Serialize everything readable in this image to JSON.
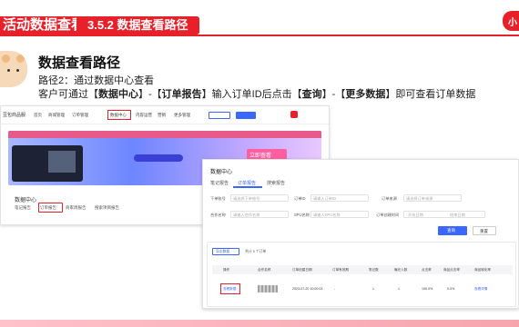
{
  "header": {
    "tag": "活动数据查看",
    "section": "3.5.2 数据查看路径",
    "brand": "小"
  },
  "content": {
    "title": "数据查看路径",
    "line1": "路径2：通过数据中心查看",
    "line2_prefix": "客户可通过【",
    "line2_parts": [
      "数据中心",
      "】-【",
      "订单报告",
      "】输入订单ID后点击【",
      "查询",
      "】-【",
      "更多数据",
      "】即可查看订单数据"
    ]
  },
  "shot1": {
    "logo": "豆包商品服",
    "nav": [
      "首页",
      "商城管理",
      "订单管理",
      "数据中心",
      "内容运营",
      "营销",
      "更多管理"
    ],
    "section_title": "数据中心",
    "tabs": [
      "笔记报告",
      "订单报告",
      "商家周报告",
      "搜索项目报告"
    ],
    "banner_text": "开播有礼",
    "banner_cta": "立即查看"
  },
  "shot2": {
    "title": "数据中心",
    "tabs": [
      "笔记报告",
      "订单报告",
      "搜索报告"
    ],
    "filters": [
      {
        "label": "下单账号",
        "placeholder": "请选择下单账号"
      },
      {
        "label": "订单ID",
        "placeholder": "请输入订单ID"
      },
      {
        "label": "订单来源",
        "placeholder": "请选择订单来源"
      },
      {
        "label": "合作名称",
        "placeholder": "请输入合作名称"
      },
      {
        "label": "SPU名称",
        "placeholder": "请输入SPU名称"
      },
      {
        "label": "订单创建时间",
        "placeholder": "开始日期"
      }
    ],
    "end_date": "结束日期",
    "search_label": "查询",
    "reset_label": "重置",
    "export_label": "导出数据",
    "count_text": "共计 5 个订单",
    "columns": [
      "操作",
      "合作名称",
      "订单创建日期",
      "订单有效期",
      "笔记数",
      "曝光人数",
      "点击率",
      "商品点击率",
      "商品转化率"
    ],
    "row": {
      "action": "查看数据",
      "date": "2023-07-20 10:00:03",
      "v1": "-",
      "v2": "1",
      "v3": "1",
      "v4": "100.0%",
      "v5": "0.0%",
      "v6": "查看详情"
    }
  }
}
